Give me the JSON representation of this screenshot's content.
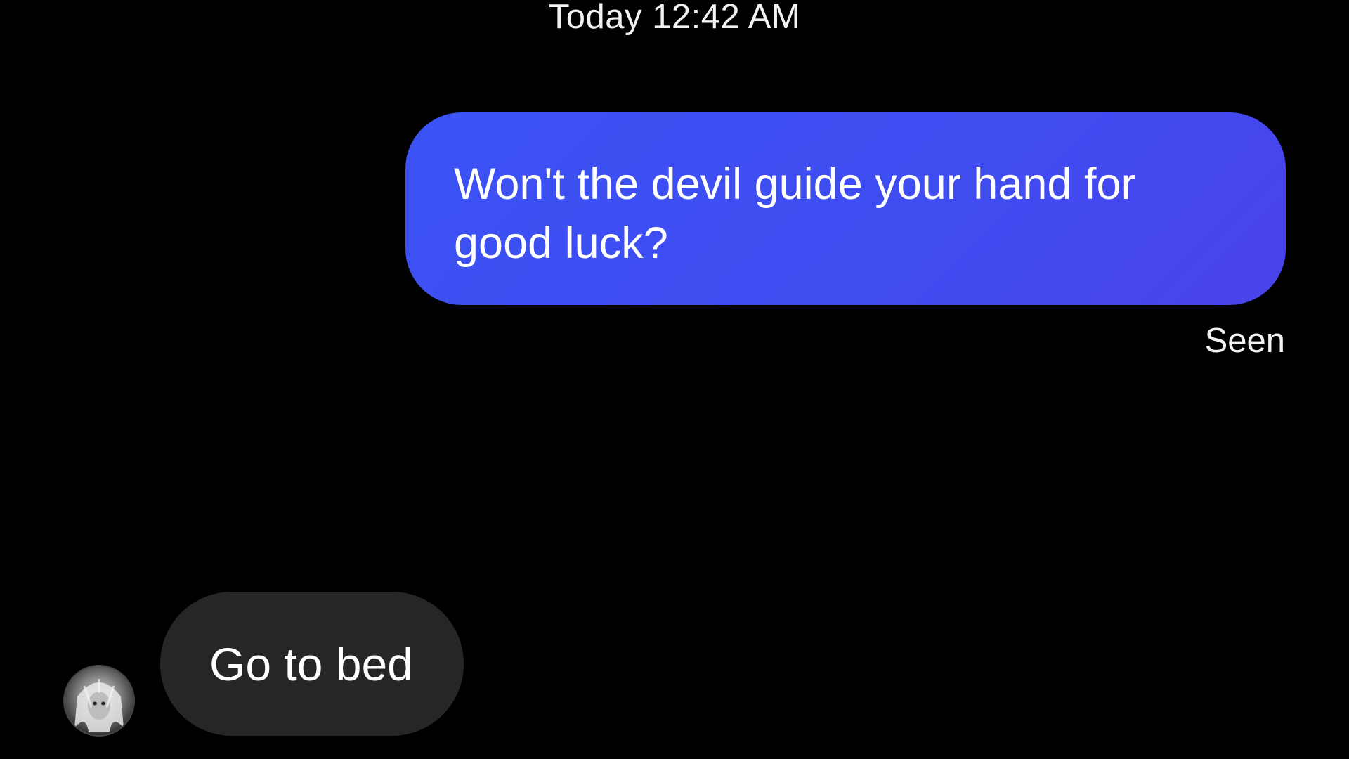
{
  "thread": {
    "timestamp": "Today 12:42 AM"
  },
  "messages": [
    {
      "direction": "sent",
      "text": "Won't the devil guide your hand for good luck?",
      "status": "Seen"
    },
    {
      "direction": "received",
      "text": "Go to bed",
      "avatar_icon": "contact-avatar"
    }
  ],
  "colors": {
    "background": "#000000",
    "sent_bubble": "#3f4cf0",
    "received_bubble": "#262626",
    "text": "#ffffff"
  }
}
